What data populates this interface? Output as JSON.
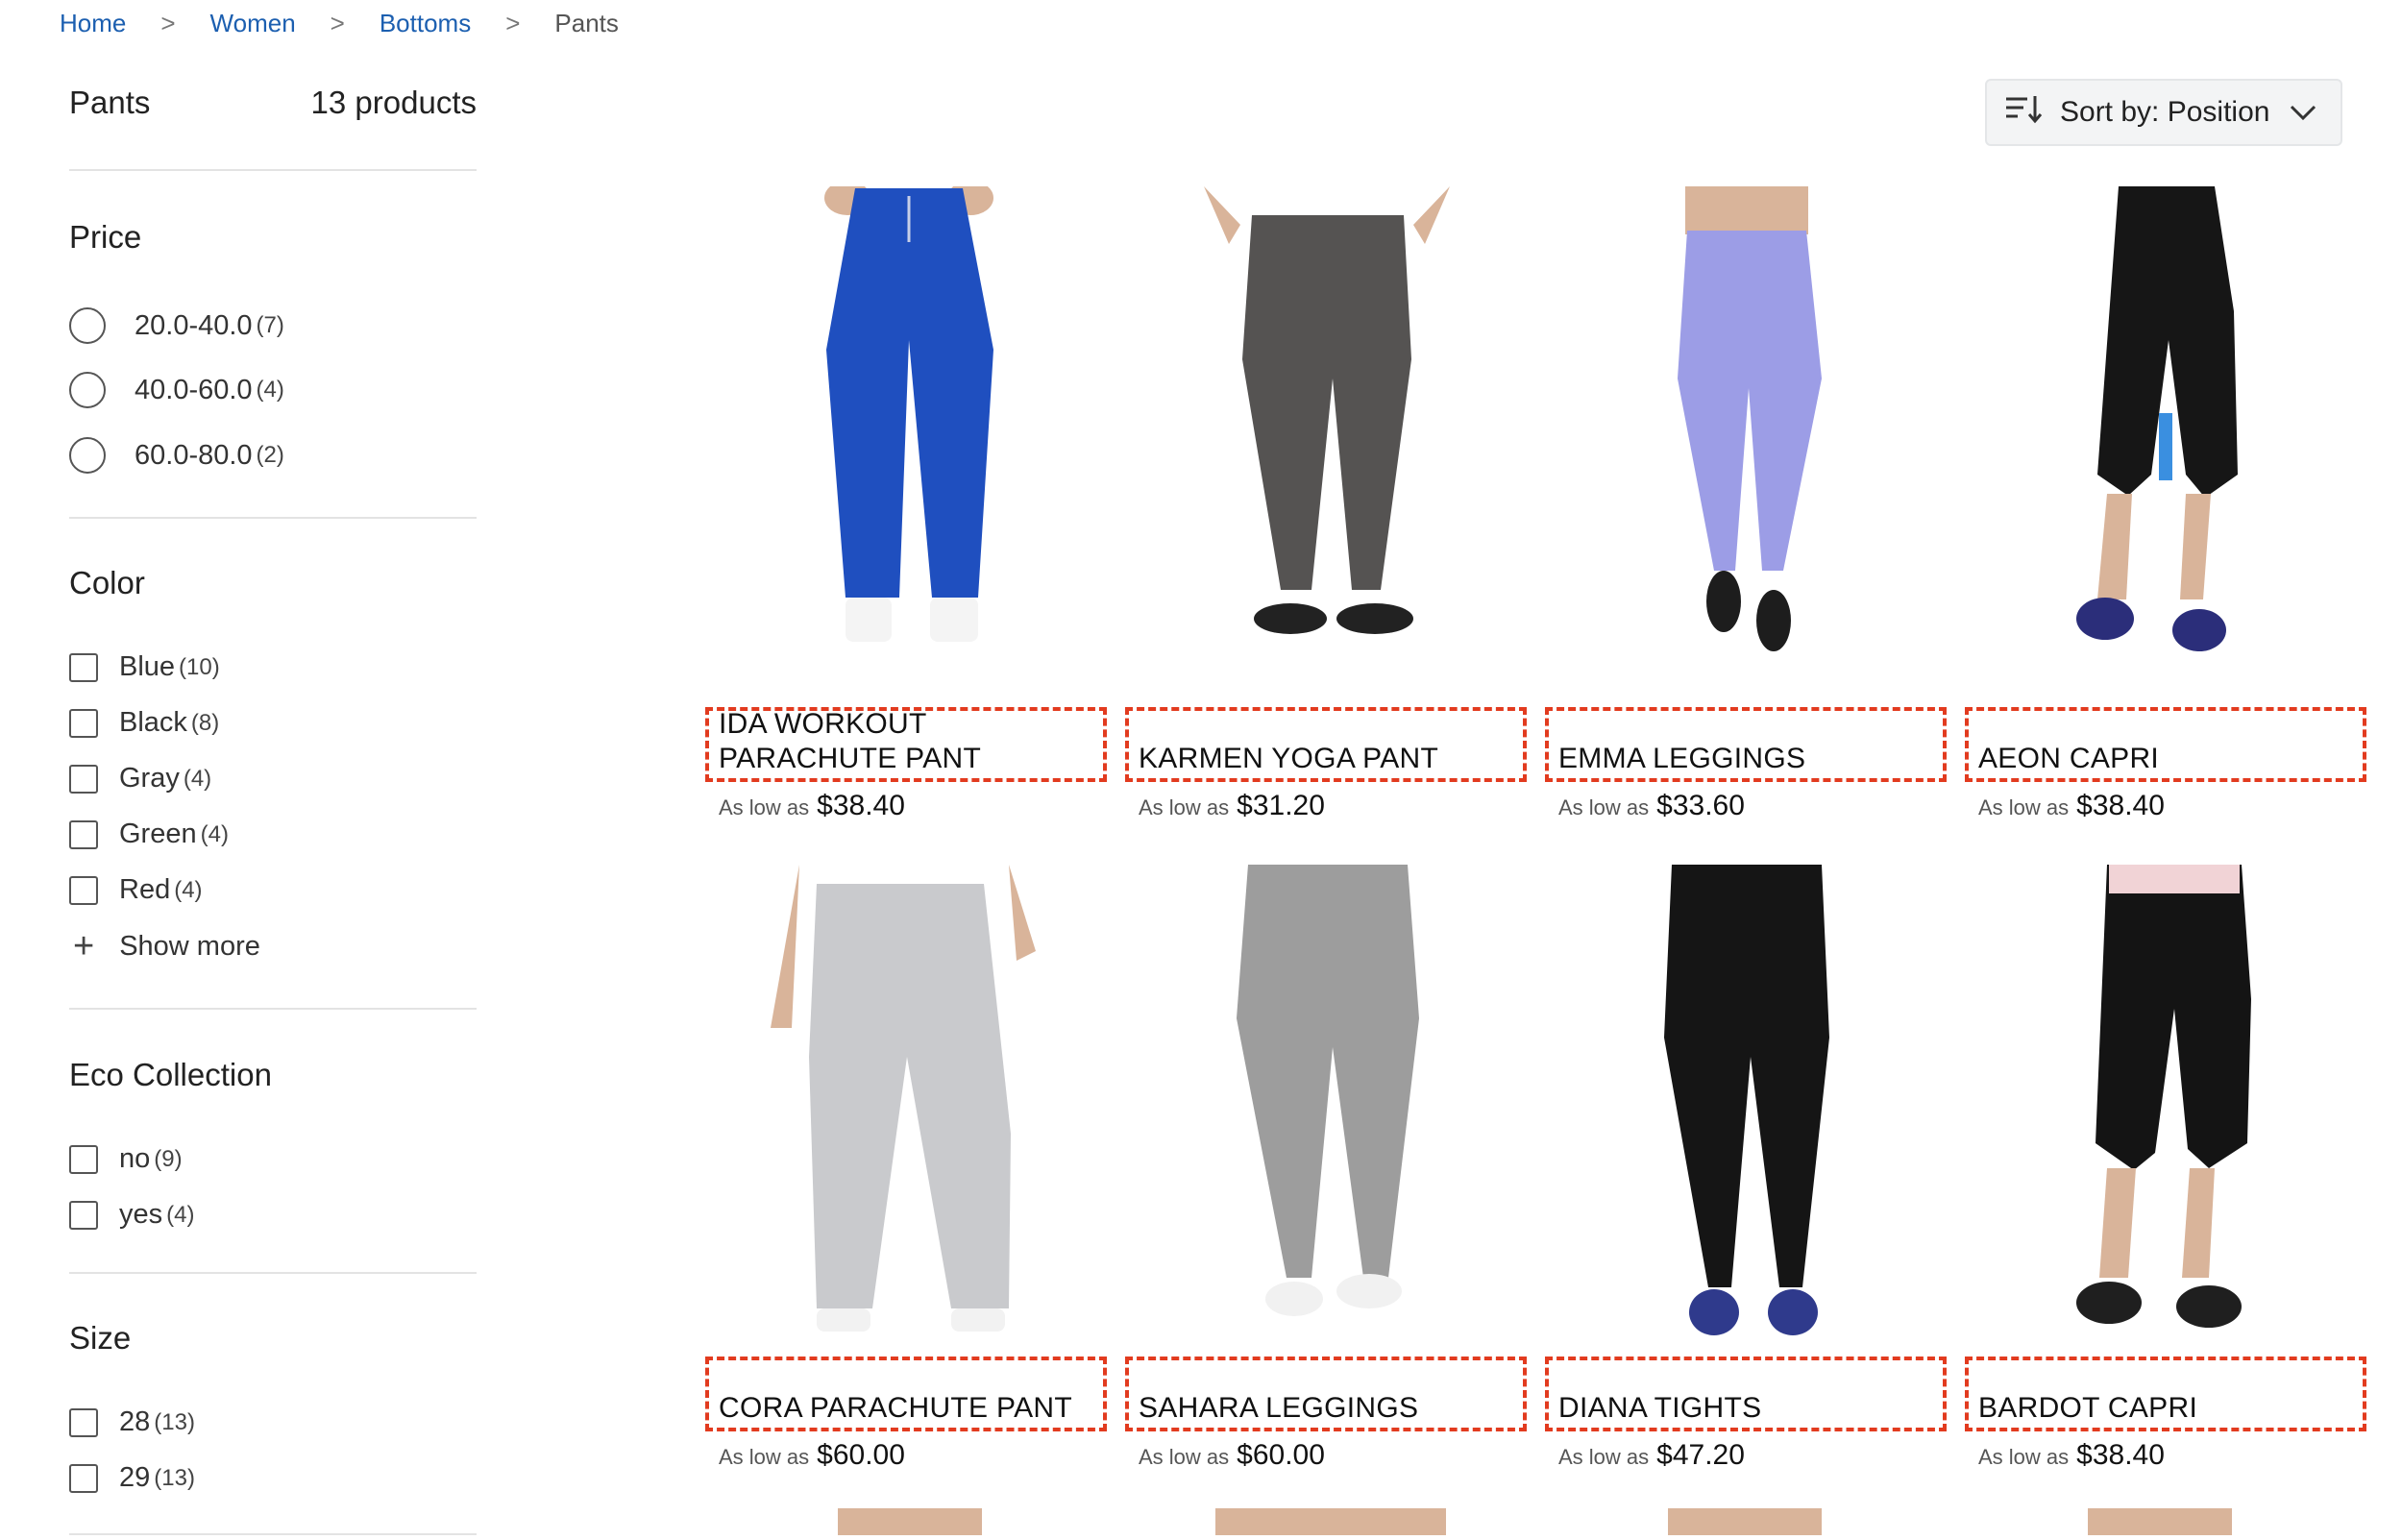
{
  "breadcrumb": {
    "items": [
      "Home",
      "Women",
      "Bottoms"
    ],
    "current": "Pants",
    "separator": ">"
  },
  "sidebar": {
    "category_title": "Pants",
    "product_count": "13 products",
    "price": {
      "title": "Price",
      "options": [
        {
          "label": "20.0-40.0",
          "count": "(7)"
        },
        {
          "label": "40.0-60.0",
          "count": "(4)"
        },
        {
          "label": "60.0-80.0",
          "count": "(2)"
        }
      ]
    },
    "color": {
      "title": "Color",
      "options": [
        {
          "label": "Blue",
          "count": "(10)"
        },
        {
          "label": "Black",
          "count": "(8)"
        },
        {
          "label": "Gray",
          "count": "(4)"
        },
        {
          "label": "Green",
          "count": "(4)"
        },
        {
          "label": "Red",
          "count": "(4)"
        }
      ],
      "show_more": "Show more"
    },
    "eco": {
      "title": "Eco Collection",
      "options": [
        {
          "label": "no",
          "count": "(9)"
        },
        {
          "label": "yes",
          "count": "(4)"
        }
      ]
    },
    "size": {
      "title": "Size",
      "options": [
        {
          "label": "28",
          "count": "(13)"
        },
        {
          "label": "29",
          "count": "(13)"
        }
      ]
    }
  },
  "toolbar": {
    "sort_label": "Sort by: Position",
    "sort_icon": "sort-icon",
    "dropdown_icon": "chevron-down-icon"
  },
  "price_prefix": "As low as",
  "products": [
    {
      "name": "IDA WORKOUT PARACHUTE PANT",
      "price": "$38.40",
      "image": "blue-parachute-joggers"
    },
    {
      "name": "KARMEN YOGA PANT",
      "price": "$31.20",
      "image": "charcoal-yoga-pant"
    },
    {
      "name": "EMMA LEGGINGS",
      "price": "$33.60",
      "image": "lavender-leggings"
    },
    {
      "name": "AEON CAPRI",
      "price": "$38.40",
      "image": "black-capri-blue-panel"
    },
    {
      "name": "CORA PARACHUTE PANT",
      "price": "$60.00",
      "image": "light-gray-parachute-pant"
    },
    {
      "name": "SAHARA LEGGINGS",
      "price": "$60.00",
      "image": "heather-gray-leggings"
    },
    {
      "name": "DIANA TIGHTS",
      "price": "$47.20",
      "image": "black-tights"
    },
    {
      "name": "BARDOT CAPRI",
      "price": "$38.40",
      "image": "black-capri-pink-waist"
    }
  ],
  "colors": {
    "link": "#1c5fb0",
    "highlight_border": "#e23b1f",
    "sort_bg": "#f3f4f5"
  }
}
